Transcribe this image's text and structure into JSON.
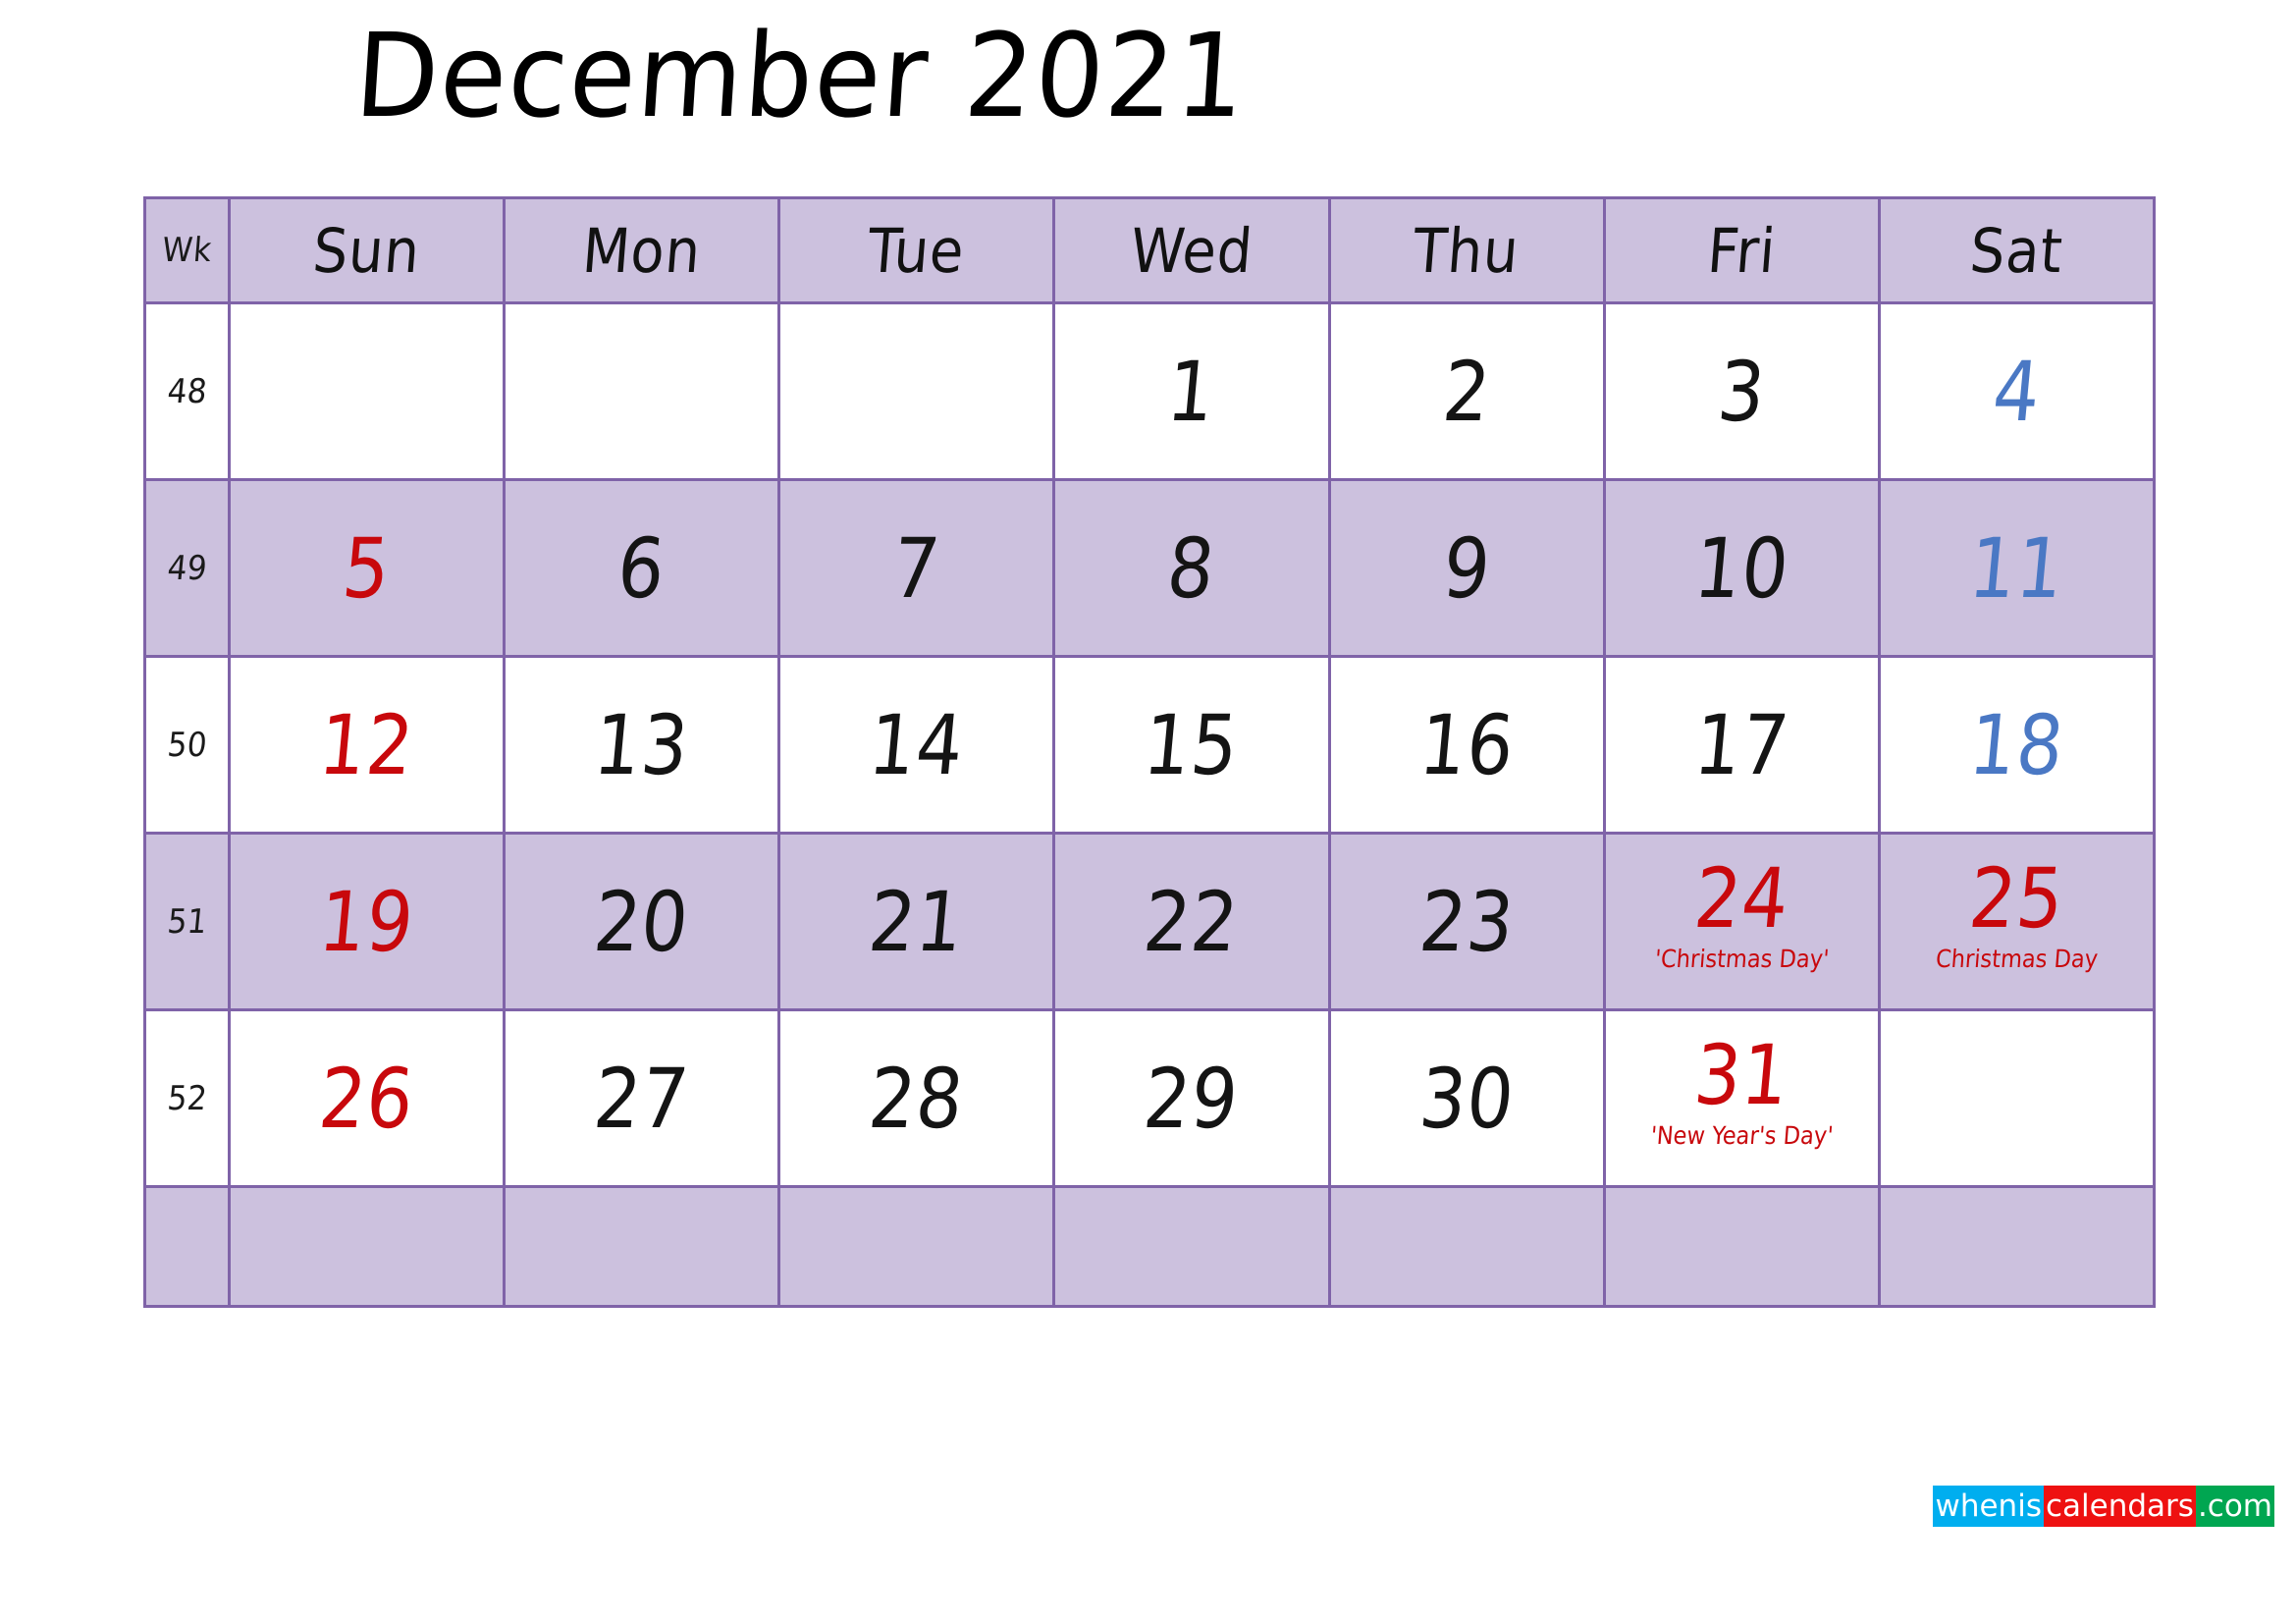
{
  "title": "December 2021",
  "colors": {
    "header_bg": "#ccc1de",
    "row_shade_bg": "#ccc1de",
    "row_plain_bg": "#ffffff",
    "border": "#7f63a8",
    "weekday_text": "#141414",
    "sunday_text": "#c8080c",
    "saturday_text": "#4a78c4",
    "holiday_text": "#c8080c",
    "logo_blue": "#00aeef",
    "logo_red": "#ee1111",
    "logo_green": "#00a651"
  },
  "header": {
    "wk_label": "Wk",
    "days": [
      "Sun",
      "Mon",
      "Tue",
      "Wed",
      "Thu",
      "Fri",
      "Sat"
    ]
  },
  "weeks": [
    {
      "wk": "48",
      "shaded": false,
      "days": [
        {
          "num": "",
          "event": "",
          "kind": "empty"
        },
        {
          "num": "",
          "event": "",
          "kind": "empty"
        },
        {
          "num": "",
          "event": "",
          "kind": "empty"
        },
        {
          "num": "1",
          "event": "",
          "kind": "weekday"
        },
        {
          "num": "2",
          "event": "",
          "kind": "weekday"
        },
        {
          "num": "3",
          "event": "",
          "kind": "weekday"
        },
        {
          "num": "4",
          "event": "",
          "kind": "saturday"
        }
      ]
    },
    {
      "wk": "49",
      "shaded": true,
      "days": [
        {
          "num": "5",
          "event": "",
          "kind": "sunday"
        },
        {
          "num": "6",
          "event": "",
          "kind": "weekday"
        },
        {
          "num": "7",
          "event": "",
          "kind": "weekday"
        },
        {
          "num": "8",
          "event": "",
          "kind": "weekday"
        },
        {
          "num": "9",
          "event": "",
          "kind": "weekday"
        },
        {
          "num": "10",
          "event": "",
          "kind": "weekday"
        },
        {
          "num": "11",
          "event": "",
          "kind": "saturday"
        }
      ]
    },
    {
      "wk": "50",
      "shaded": false,
      "days": [
        {
          "num": "12",
          "event": "",
          "kind": "sunday"
        },
        {
          "num": "13",
          "event": "",
          "kind": "weekday"
        },
        {
          "num": "14",
          "event": "",
          "kind": "weekday"
        },
        {
          "num": "15",
          "event": "",
          "kind": "weekday"
        },
        {
          "num": "16",
          "event": "",
          "kind": "weekday"
        },
        {
          "num": "17",
          "event": "",
          "kind": "weekday"
        },
        {
          "num": "18",
          "event": "",
          "kind": "saturday"
        }
      ]
    },
    {
      "wk": "51",
      "shaded": true,
      "days": [
        {
          "num": "19",
          "event": "",
          "kind": "sunday"
        },
        {
          "num": "20",
          "event": "",
          "kind": "weekday"
        },
        {
          "num": "21",
          "event": "",
          "kind": "weekday"
        },
        {
          "num": "22",
          "event": "",
          "kind": "weekday"
        },
        {
          "num": "23",
          "event": "",
          "kind": "weekday"
        },
        {
          "num": "24",
          "event": "'Christmas Day'",
          "kind": "holiday"
        },
        {
          "num": "25",
          "event": "Christmas Day",
          "kind": "holiday"
        }
      ]
    },
    {
      "wk": "52",
      "shaded": false,
      "days": [
        {
          "num": "26",
          "event": "",
          "kind": "sunday"
        },
        {
          "num": "27",
          "event": "",
          "kind": "weekday"
        },
        {
          "num": "28",
          "event": "",
          "kind": "weekday"
        },
        {
          "num": "29",
          "event": "",
          "kind": "weekday"
        },
        {
          "num": "30",
          "event": "",
          "kind": "weekday"
        },
        {
          "num": "31",
          "event": "'New Year's Day'",
          "kind": "holiday"
        },
        {
          "num": "",
          "event": "",
          "kind": "empty"
        }
      ]
    },
    {
      "wk": "",
      "shaded": true,
      "blank": true,
      "days": [
        {
          "num": "",
          "event": "",
          "kind": "empty"
        },
        {
          "num": "",
          "event": "",
          "kind": "empty"
        },
        {
          "num": "",
          "event": "",
          "kind": "empty"
        },
        {
          "num": "",
          "event": "",
          "kind": "empty"
        },
        {
          "num": "",
          "event": "",
          "kind": "empty"
        },
        {
          "num": "",
          "event": "",
          "kind": "empty"
        },
        {
          "num": "",
          "event": "",
          "kind": "empty"
        }
      ]
    }
  ],
  "logo": {
    "part1": "whenis",
    "part2": "calendars",
    "part3": ".com"
  }
}
